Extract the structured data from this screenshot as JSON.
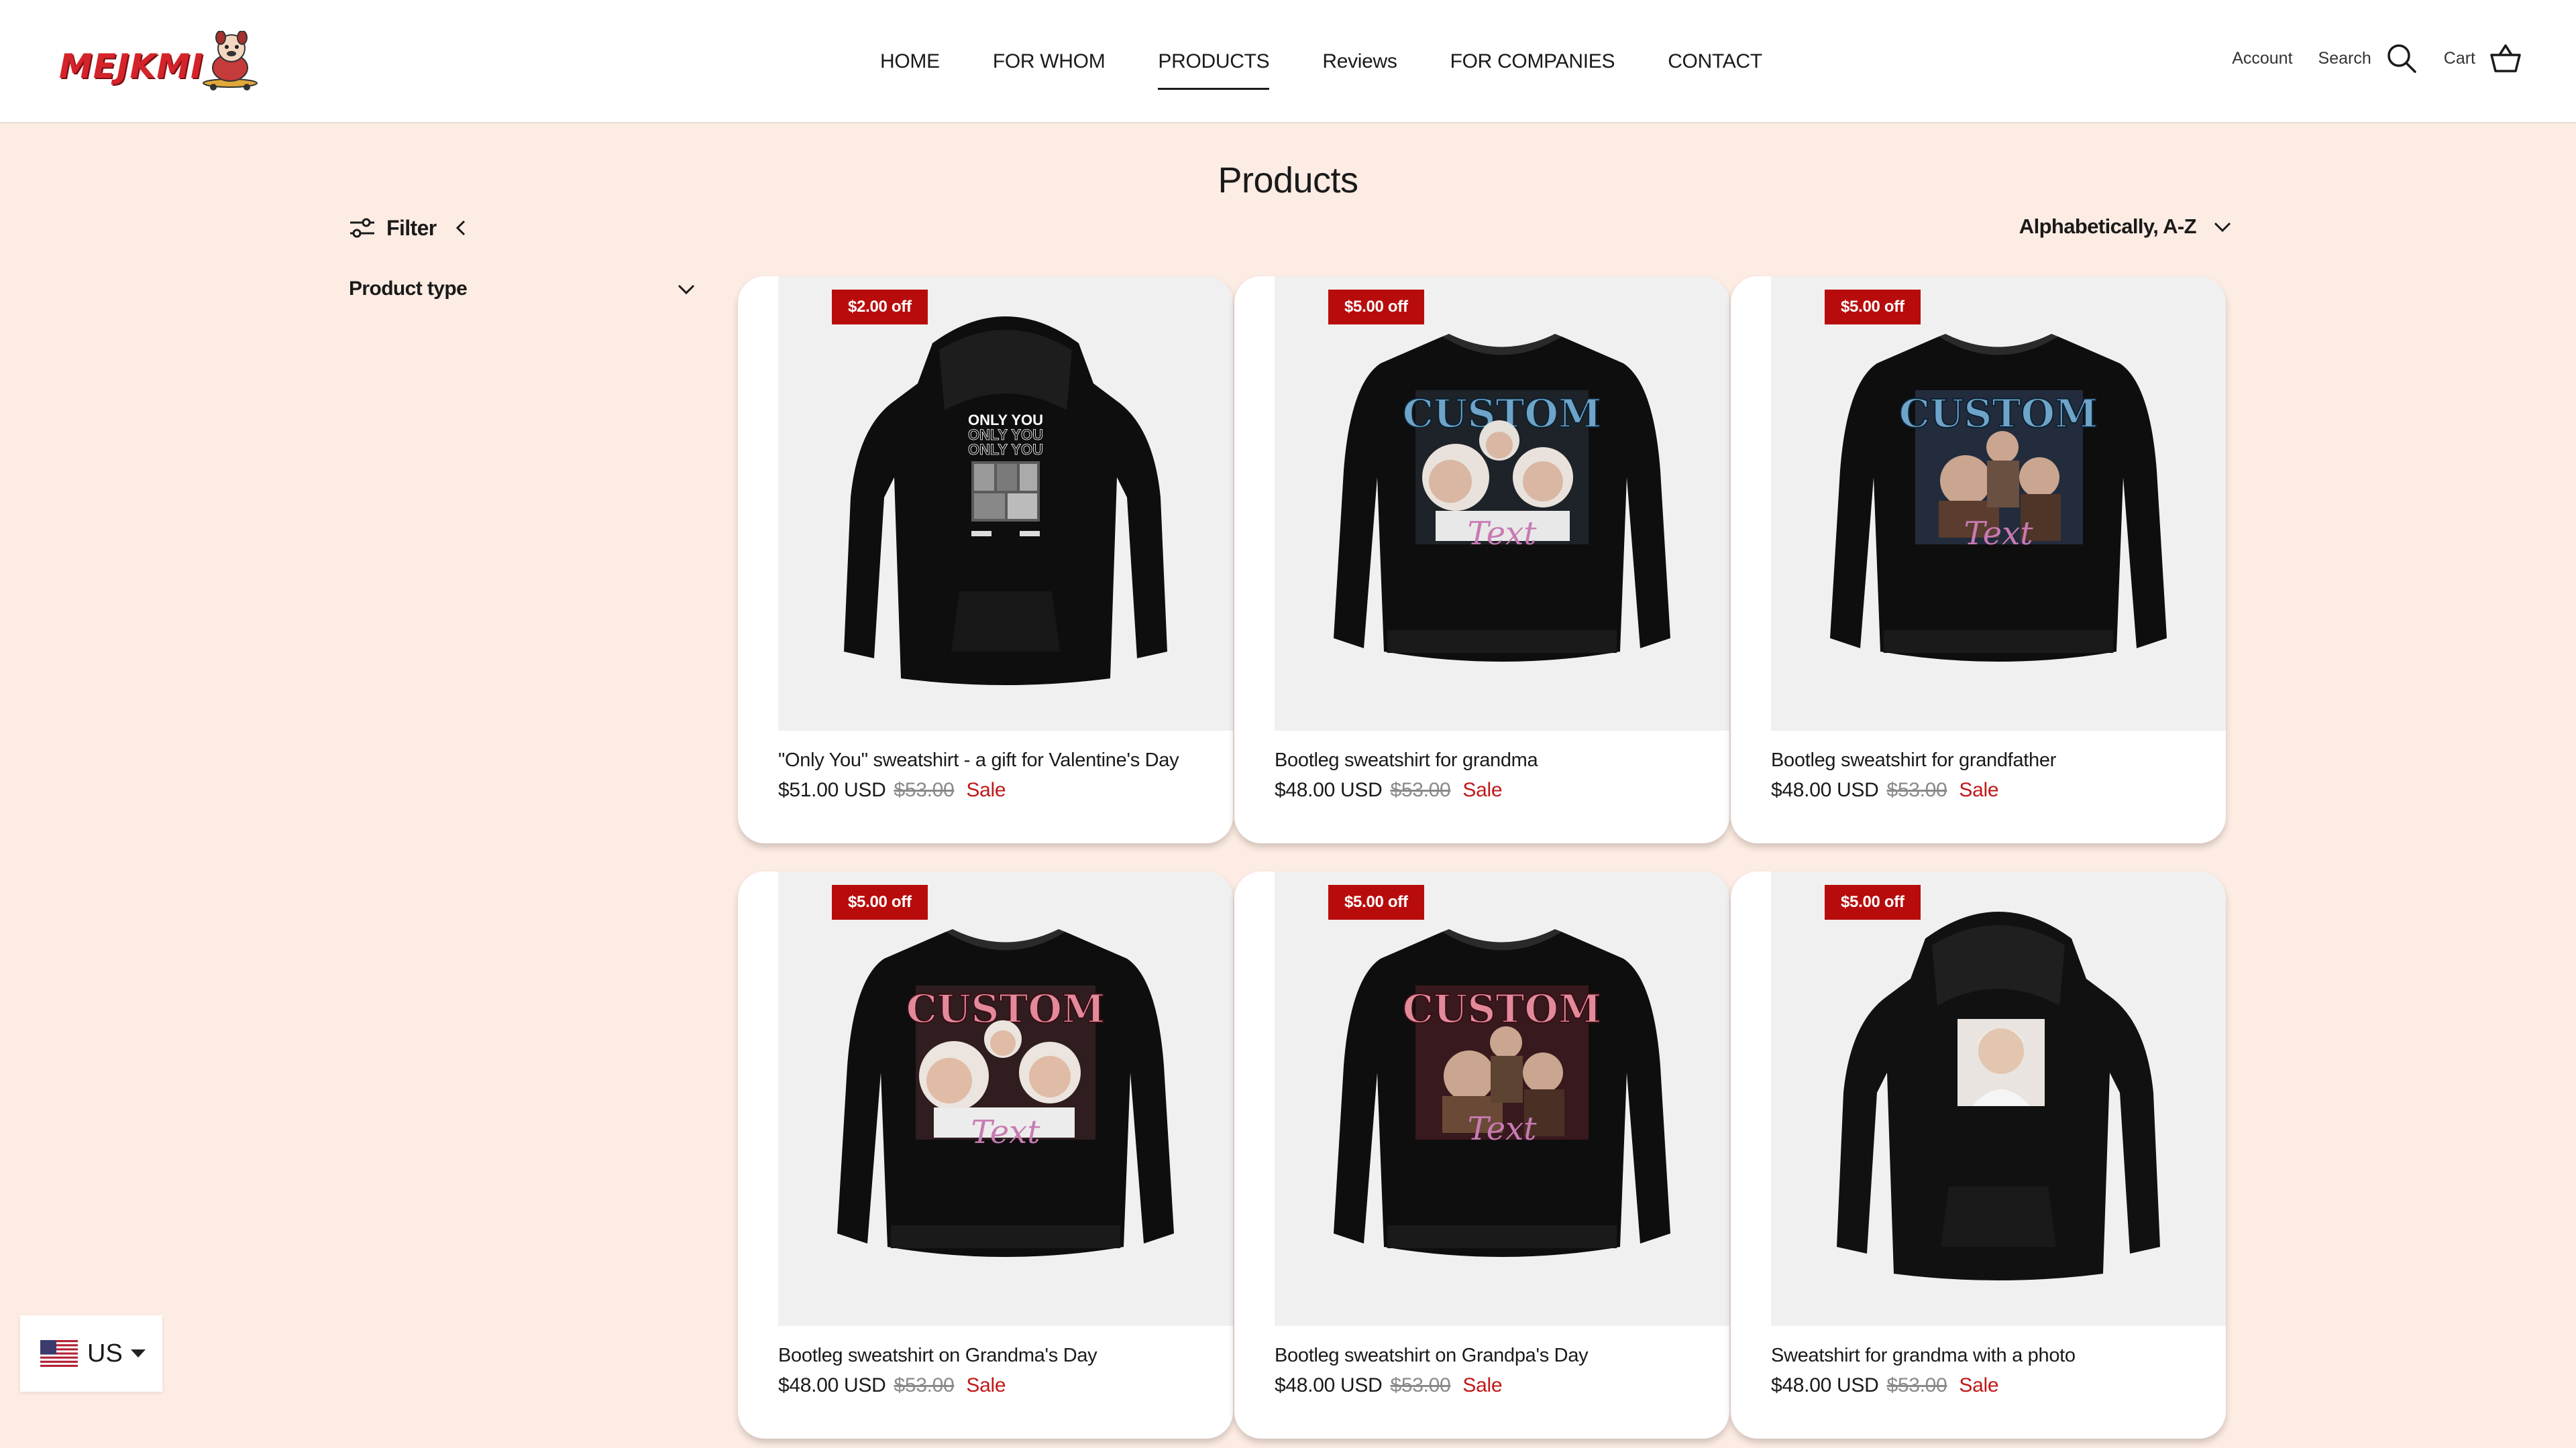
{
  "header": {
    "logo_text": "MEJKMI",
    "nav": [
      {
        "label": "HOME",
        "active": false
      },
      {
        "label": "FOR WHOM",
        "active": false
      },
      {
        "label": "PRODUCTS",
        "active": true
      },
      {
        "label": "Reviews",
        "active": false
      },
      {
        "label": "FOR COMPANIES",
        "active": false
      },
      {
        "label": "CONTACT",
        "active": false
      }
    ],
    "account_label": "Account",
    "search_label": "Search",
    "cart_label": "Cart"
  },
  "page": {
    "title": "Products"
  },
  "filters": {
    "toggle_label": "Filter",
    "groups": [
      {
        "label": "Product type"
      }
    ]
  },
  "sort": {
    "selected": "Alphabetically, A-Z"
  },
  "products": [
    {
      "badge": "$2.00 off",
      "title": "\"Only You\" sweatshirt - a gift for Valentine's Day",
      "price": "$51.00 USD",
      "compare_price": "$53.00",
      "sale_label": "Sale",
      "garment": "hoodie",
      "print": "only-you"
    },
    {
      "badge": "$5.00 off",
      "title": "Bootleg sweatshirt for grandma",
      "price": "$48.00 USD",
      "compare_price": "$53.00",
      "sale_label": "Sale",
      "garment": "crewneck",
      "print": "custom-blue"
    },
    {
      "badge": "$5.00 off",
      "title": "Bootleg sweatshirt for grandfather",
      "price": "$48.00 USD",
      "compare_price": "$53.00",
      "sale_label": "Sale",
      "garment": "crewneck",
      "print": "custom-blue"
    },
    {
      "badge": "$5.00 off",
      "title": "Bootleg sweatshirt on Grandma's Day",
      "price": "$48.00 USD",
      "compare_price": "$53.00",
      "sale_label": "Sale",
      "garment": "crewneck",
      "print": "custom-pink"
    },
    {
      "badge": "$5.00 off",
      "title": "Bootleg sweatshirt on Grandpa's Day",
      "price": "$48.00 USD",
      "compare_price": "$53.00",
      "sale_label": "Sale",
      "garment": "crewneck",
      "print": "custom-pink"
    },
    {
      "badge": "$5.00 off",
      "title": "Sweatshirt for grandma with a photo",
      "price": "$48.00 USD",
      "compare_price": "$53.00",
      "sale_label": "Sale",
      "garment": "hoodie",
      "print": "photo"
    }
  ],
  "print_text": {
    "only_you": "ONLY YOU",
    "custom": "CUSTOM",
    "text": "Text"
  },
  "currency": {
    "code": "US"
  },
  "colors": {
    "page_bg": "#fdece3",
    "badge_bg": "#b80c0c",
    "sale_text": "#c01818",
    "logo_red": "#d5232a"
  }
}
